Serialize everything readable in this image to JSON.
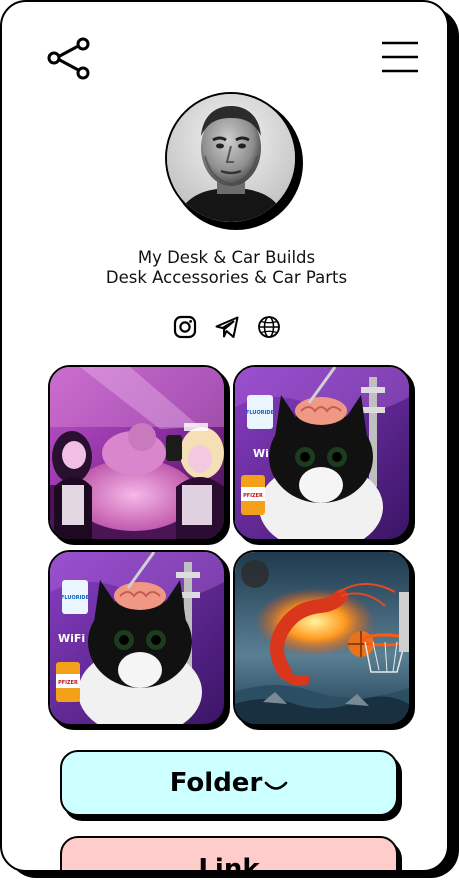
{
  "profile": {
    "bio_line1": "My Desk & Car Builds",
    "bio_line2": "Desk Accessories & Car Parts"
  },
  "header": {
    "share_icon": "share-icon",
    "menu_icon": "hamburger-menu-icon"
  },
  "socials": [
    "instagram-icon",
    "telegram-icon",
    "globe-icon"
  ],
  "gallery": [
    {
      "name": "gallery-tile-maid-party",
      "subject": "photo"
    },
    {
      "name": "gallery-tile-cat-brain-1",
      "subject": "photo"
    },
    {
      "name": "gallery-tile-cat-brain-2",
      "subject": "photo"
    },
    {
      "name": "gallery-tile-shrimp-basketball",
      "subject": "photo"
    }
  ],
  "cat_tile_text": {
    "cup": "FLUORIDE",
    "wifi": "WiFi",
    "bottle": "PFIZER"
  },
  "buttons": {
    "folder_label": "Folder",
    "folder_chevron": "⁀",
    "link_label": "Link"
  },
  "colors": {
    "folder_bg": "#ccffff",
    "link_bg": "#ffcccc",
    "ink": "#000000"
  }
}
